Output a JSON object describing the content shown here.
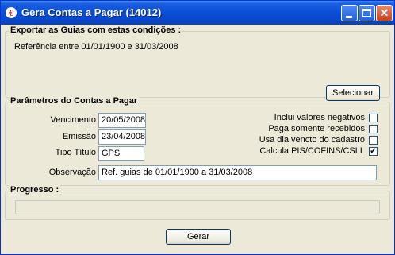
{
  "window": {
    "title": "Gera Contas a Pagar (14012)",
    "app_icon_glyph": "€",
    "icons": [
      "app-icon",
      "minimize-icon",
      "maximize-icon",
      "close-icon"
    ],
    "close_glyph": "✕"
  },
  "exportar": {
    "title": "Exportar as Guias com estas condições :",
    "referencia": "Referência entre 01/01/1900 e 31/03/2008",
    "select_button": "Selecionar"
  },
  "parametros": {
    "title": "Parâmetros do Contas a Pagar",
    "vencimento_label": "Vencimento",
    "vencimento_value": "20/05/2008",
    "emissao_label": "Emissão",
    "emissao_value": "23/04/2008",
    "tipo_label": "Tipo Título",
    "tipo_value": "GPS",
    "obs_label": "Observação",
    "obs_value": "Ref. guias de 01/01/1900 a 31/03/2008",
    "checkboxes": [
      {
        "label": "Inclui valores negativos",
        "checked": false,
        "mark": ""
      },
      {
        "label": "Paga somente recebidos",
        "checked": false,
        "mark": ""
      },
      {
        "label": "Usa dia vencto do cadastro",
        "checked": false,
        "mark": ""
      },
      {
        "label": "Calcula PIS/COFINS/CSLL",
        "checked": true,
        "mark": "✔"
      }
    ]
  },
  "progresso": {
    "title": "Progresso :",
    "value": 0
  },
  "gerar_button": "Gerar"
}
